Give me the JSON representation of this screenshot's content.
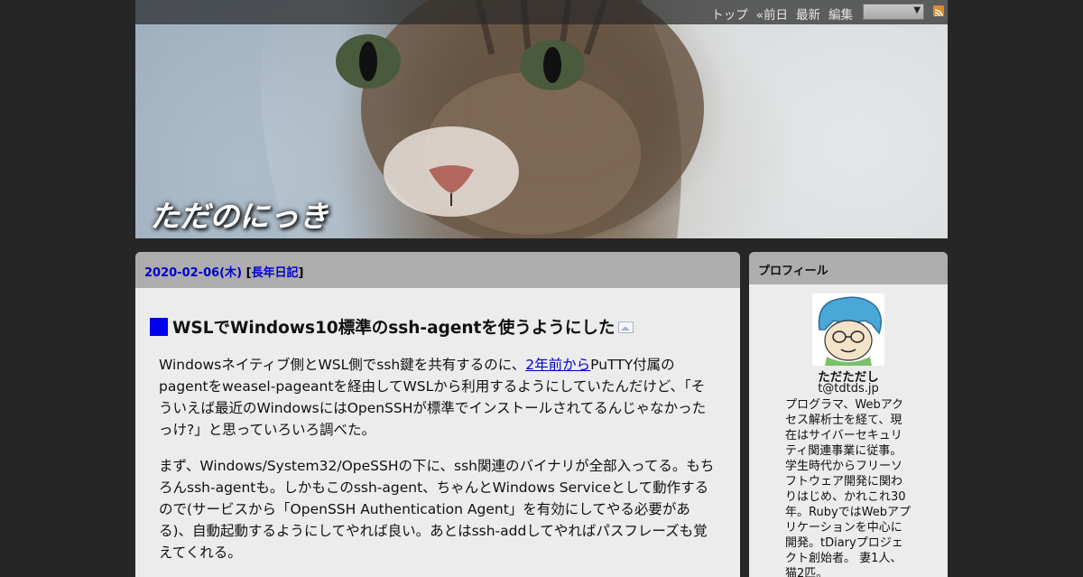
{
  "header": {
    "site_title": "ただのにっき",
    "nav": [
      "トップ",
      "«前日",
      "最新",
      "編集"
    ],
    "rss_icon": "rss-icon"
  },
  "day": {
    "date": "2020-02-06(木)",
    "category": "長年日記"
  },
  "entry": {
    "title": "WSLでWindows10標準のssh-agentを使うようにした",
    "p1_before": "Windowsネイティブ側とWSL側でssh鍵を共有するのに、",
    "p1_link": "2年前から",
    "p1_after": "PuTTY付属のpagentをweasel-pageantを経由してWSLから利用するようにしていたんだけど、「そういえば最近のWindowsにはOpenSSHが標準でインストールされてるんじゃなかったっけ?」と思っていろいろ調べた。",
    "p2": "まず、Windows/System32/OpeSSHの下に、ssh関連のバイナリが全部入ってる。もちろんssh-agentも。しかもこのssh-agent、ちゃんとWindows Serviceとして動作するので(サービスから「OpenSSH Authentication Agent」を有効にしてやる必要がある)、自動起動するようにしてやれば良い。あとはssh-addしてやればパスフレーズも覚えてくれる。"
  },
  "sidebar": {
    "heading": "プロフィール",
    "name": "ただただし",
    "mail": "t@tdtds.jp",
    "bio": "プログラマ、Webアクセス解析士を経て、現在はサイバーセキュリティ関連事業に従事。学生時代からフリーソフトウェア開発に関わりはじめ、かれこれ30年。RubyではWebアプリケーションを中心に開発。tDiaryプロジェクト創始者。 妻1人、猫2匹。"
  },
  "colors": {
    "background": "#262626",
    "panel": "#ececec",
    "panel_header": "#adadad",
    "link": "#0000cc",
    "title_mark": "#0000ee"
  }
}
